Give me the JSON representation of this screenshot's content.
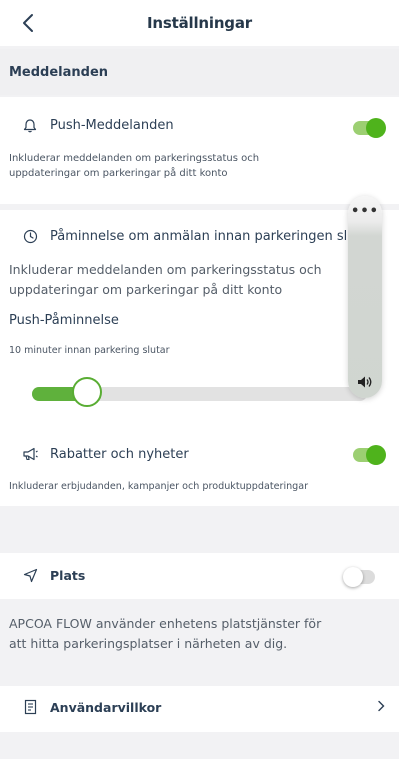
{
  "header": {
    "title": "Inställningar"
  },
  "sections": {
    "notifications_header": "Meddelanden"
  },
  "push": {
    "title": "Push-Meddelanden",
    "desc_line1": "Inkluderar meddelanden om parkeringsstatus och",
    "desc_line2": "uppdateringar om parkeringar på ditt konto",
    "enabled": true
  },
  "reminder": {
    "title": "Påminnelse om anmälan innan parkeringen slut",
    "desc_line1": "Inkluderar meddelanden om parkeringsstatus och",
    "desc_line2": "uppdateringar om parkeringar på ditt konto",
    "push_label": "Push-Påminnelse",
    "sub_label": "10 minuter innan parkering slutar",
    "slider_fraction": 0.15
  },
  "offers": {
    "title": "Rabatter och nyheter",
    "desc": "Inkluderar erbjudanden, kampanjer och produktuppdateringar",
    "enabled": true
  },
  "location": {
    "title": "Plats",
    "enabled": false,
    "info_line1": "APCOA FLOW använder enhetens platstjänster för",
    "info_line2": "att hitta parkeringsplatser i närheten av dig."
  },
  "terms": {
    "title": "Användarvillkor"
  },
  "volume_overlay": {
    "dots": "•••"
  },
  "colors": {
    "accent": "#4fb31c",
    "text": "#2c3f55",
    "background": "#f2f2f4"
  },
  "icons": {
    "back": "chevron-left-icon",
    "push": "bell-icon",
    "reminder": "clock-icon",
    "offers": "megaphone-icon",
    "location": "location-arrow-icon",
    "terms": "document-icon",
    "terms_chevron": "chevron-right-icon",
    "volume": "speaker-icon"
  }
}
